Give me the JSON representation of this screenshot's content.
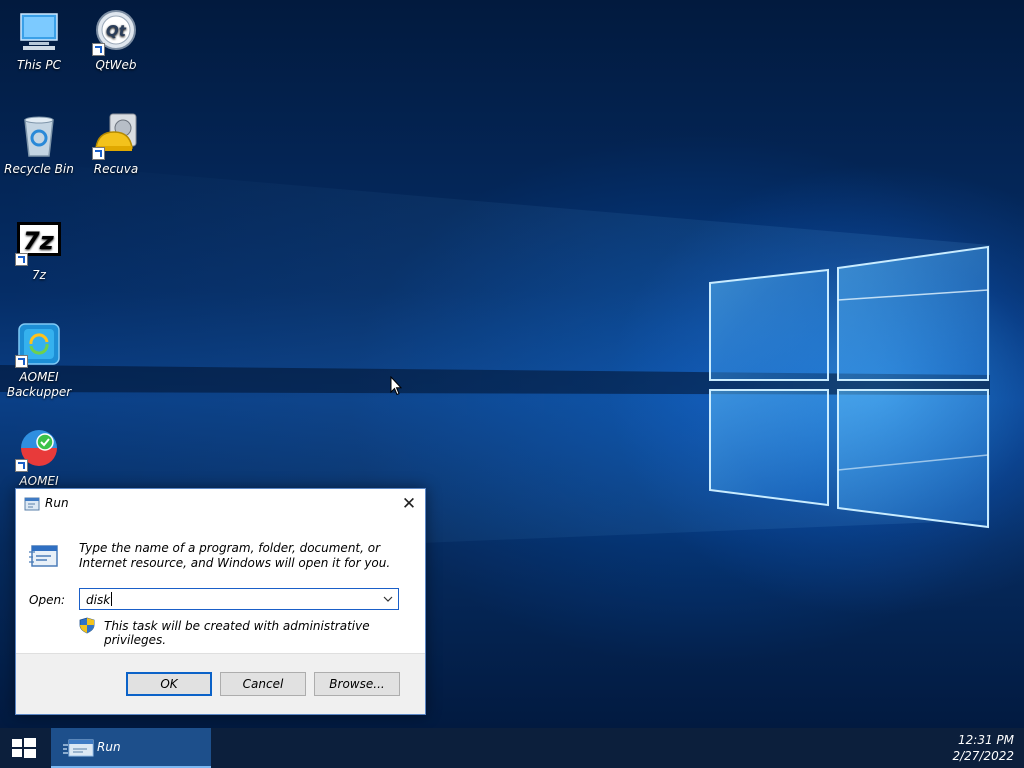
{
  "desktop": {
    "icons": [
      {
        "label": "This PC",
        "icon": "computer-icon"
      },
      {
        "label": "QtWeb",
        "icon": "qtweb-icon"
      },
      {
        "label": "Recycle Bin",
        "icon": "recycle-bin-icon"
      },
      {
        "label": "Recuva",
        "icon": "recuva-icon"
      },
      {
        "label": "7z",
        "icon": "7zip-icon"
      },
      {
        "label": "AOMEI Backupper",
        "icon": "aomei-backupper-icon"
      },
      {
        "label": "AOMEI",
        "icon": "aomei-partition-icon"
      }
    ]
  },
  "run_dialog": {
    "title": "Run",
    "close_glyph": "✕",
    "description": "Type the name of a program, folder, document, or Internet resource, and Windows will open it for you.",
    "open_label": "Open:",
    "open_value": "disk",
    "admin_note": "This task will be created with administrative privileges.",
    "ok_label": "OK",
    "cancel_label": "Cancel",
    "browse_label": "Browse..."
  },
  "taskbar": {
    "items": [
      {
        "label": "Run",
        "icon": "run-icon",
        "active": true
      }
    ],
    "time": "12:31 PM",
    "date": "2/27/2022"
  },
  "colors": {
    "accent": "#0b62c8",
    "taskbar": "#0c1f3c",
    "task_active": "#1d4f8b"
  }
}
